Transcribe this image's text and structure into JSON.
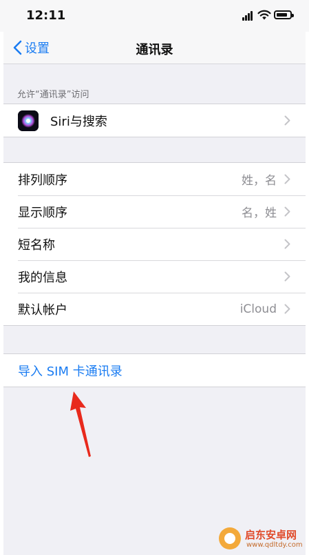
{
  "status_bar": {
    "time": "12:11"
  },
  "nav": {
    "back_label": "设置",
    "title": "通讯录"
  },
  "siri_section": {
    "header": "允许“通讯录”访问",
    "item_label": "Siri与搜索"
  },
  "settings": [
    {
      "label": "排列顺序",
      "value": "姓，名"
    },
    {
      "label": "显示顺序",
      "value": "名，姓"
    },
    {
      "label": "短名称",
      "value": ""
    },
    {
      "label": "我的信息",
      "value": ""
    },
    {
      "label": "默认帐户",
      "value": "iCloud"
    }
  ],
  "import": {
    "label": "导入 SIM 卡通讯录"
  },
  "annotation": {
    "arrow_color": "#e8291c"
  },
  "watermark": {
    "name": "启东安卓网",
    "url": "www.qdltdy.com"
  },
  "colors": {
    "accent": "#1a7cf2",
    "background": "#f0f0f5"
  },
  "icons": [
    "chevron-left-icon",
    "siri-icon",
    "chevron-right-icon",
    "signal-icon",
    "wifi-icon",
    "battery-icon"
  ]
}
